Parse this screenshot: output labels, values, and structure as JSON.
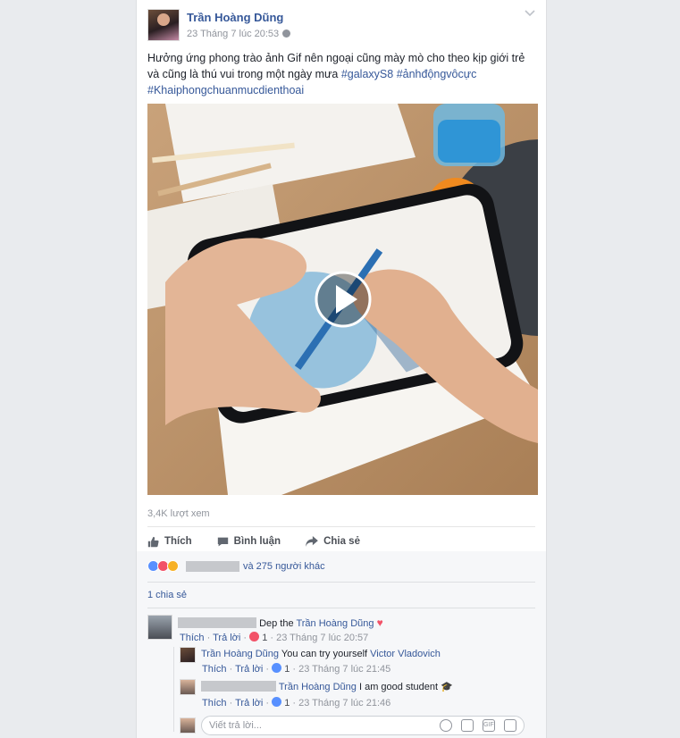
{
  "post": {
    "author": "Trần Hoàng Dũng",
    "timestamp": "23 Tháng 7 lúc 20:53",
    "text_line1": "Hưởng ứng phong trào ảnh Gif nên ngoại cũng mày mò cho theo kịp giới trẻ",
    "text_line2": "và cũng là thú vui trong một ngày mưa ",
    "hashtag1": "#galaxyS8",
    "hashtag2": "#ảnhđộngvôcực",
    "hashtag3": "#Khaiphongchuanmucdienthoai",
    "views": "3,4K lượt xem"
  },
  "actions": {
    "like": "Thích",
    "comment": "Bình luận",
    "share": "Chia sẻ"
  },
  "reactions": {
    "text": "và 275 người khác"
  },
  "shares": "1 chia sẻ",
  "comments": [
    {
      "text": "Dep the ",
      "mention": "Trần Hoàng Dũng",
      "like_label": "Thích",
      "reply_label": "Trả lời",
      "reaction_count": "1",
      "time": "23 Tháng 7 lúc 20:57"
    },
    {
      "author": "Trần Hoàng Dũng",
      "text": " You can try yourself ",
      "mention": "Victor Vladovich",
      "like_label": "Thích",
      "reply_label": "Trả lời",
      "reaction_count": "1",
      "time": "23 Tháng 7 lúc 21:45"
    },
    {
      "mention": "Trần Hoàng Dũng",
      "text": " I am good student",
      "like_label": "Thích",
      "reply_label": "Trả lời",
      "reaction_count": "1",
      "time": "23 Tháng 7 lúc 21:46"
    }
  ],
  "reply_input": {
    "placeholder": "Viết trả lời..."
  },
  "icons": {
    "globe": "globe-icon",
    "chevron": "chevron-down-icon",
    "play": "play-icon",
    "like": "thumbs-up-icon",
    "comment": "comment-icon",
    "share": "share-arrow-icon",
    "emoji": "emoji-icon",
    "camera": "camera-icon",
    "gif": "gif-icon",
    "sticker": "sticker-icon"
  },
  "colors": {
    "link": "#365899",
    "like": "#5890ff",
    "heart": "#f25268",
    "wow": "#f7b125"
  }
}
